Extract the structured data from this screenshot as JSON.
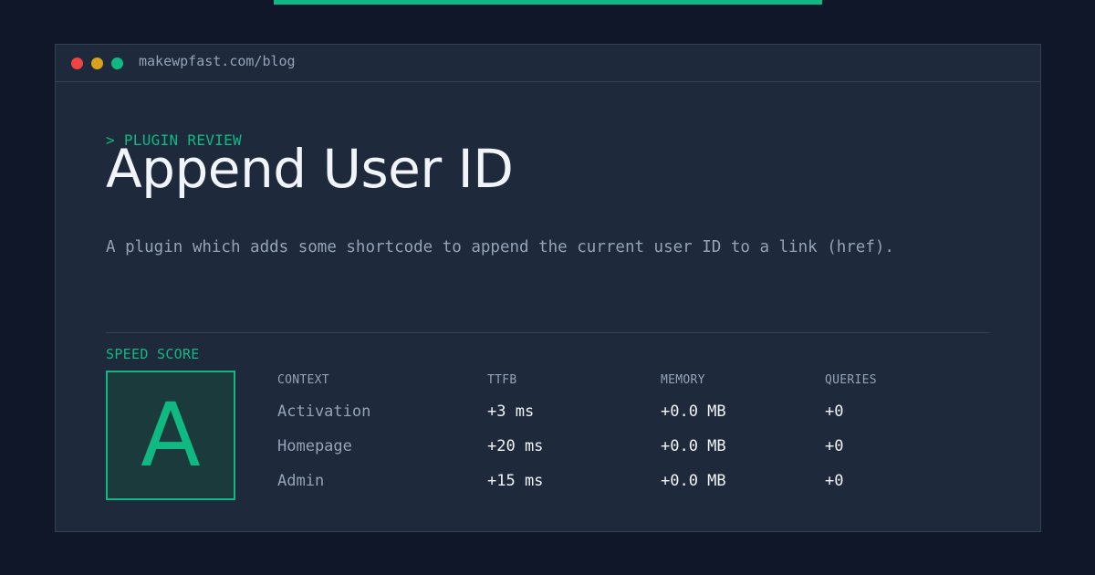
{
  "colors": {
    "accent": "#10b981",
    "background": "#0f1729",
    "window": "#1e293b",
    "dot_red": "#ef4444",
    "dot_yellow": "#d9a21b",
    "dot_green": "#10b981"
  },
  "browser": {
    "url": "makewpfast.com/blog",
    "dots": [
      "close-dot",
      "minimize-dot",
      "maximize-dot"
    ]
  },
  "header": {
    "eyebrow": "> PLUGIN REVIEW",
    "title": "Append User ID",
    "description": "A plugin which adds some shortcode to append the current user ID to a link (href)."
  },
  "score": {
    "label": "SPEED SCORE",
    "grade": "A"
  },
  "metrics": {
    "columns": [
      "CONTEXT",
      "TTFB",
      "MEMORY",
      "QUERIES"
    ],
    "rows": [
      [
        "Activation",
        "+3 ms",
        "+0.0 MB",
        "+0"
      ],
      [
        "Homepage",
        "+20 ms",
        "+0.0 MB",
        "+0"
      ],
      [
        "Admin",
        "+15 ms",
        "+0.0 MB",
        "+0"
      ]
    ]
  }
}
